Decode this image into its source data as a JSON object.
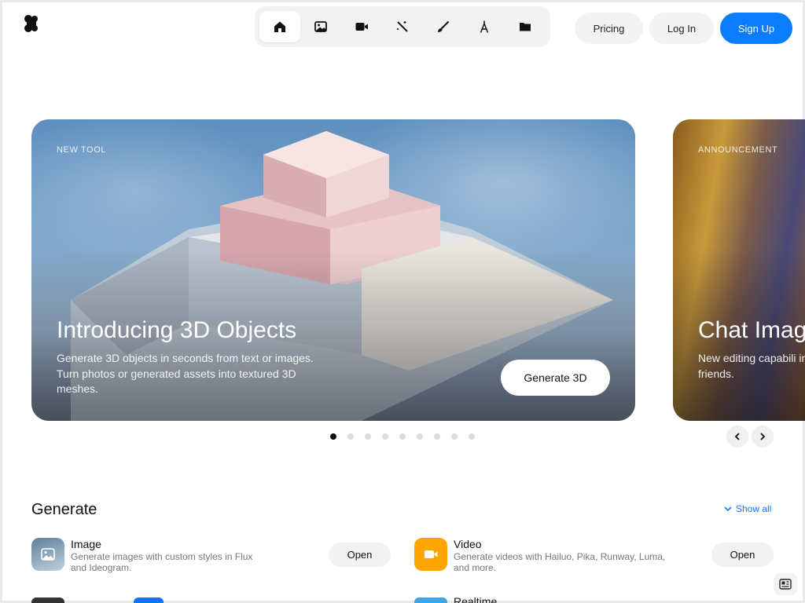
{
  "header": {
    "logo_icon": "krea-logo-icon",
    "nav": [
      {
        "icon": "home-icon",
        "active": true
      },
      {
        "icon": "image-icon",
        "active": false
      },
      {
        "icon": "video-camera-icon",
        "active": false
      },
      {
        "icon": "magic-wand-icon",
        "active": false
      },
      {
        "icon": "brush-icon",
        "active": false
      },
      {
        "icon": "pen-nib-icon",
        "active": false
      },
      {
        "icon": "folder-icon",
        "active": false
      }
    ],
    "pricing_label": "Pricing",
    "login_label": "Log In",
    "signup_label": "Sign Up"
  },
  "hero": {
    "cards": [
      {
        "eyebrow": "NEW TOOL",
        "title": "Introducing 3D Objects",
        "description": "Generate 3D objects in seconds from text or images. Turn photos or generated assets into textured 3D meshes.",
        "button_label": "Generate 3D"
      },
      {
        "eyebrow": "ANNOUNCEMENT",
        "title": "Chat Imag",
        "description": "New editing capabili into paintings, swap y your friends."
      }
    ],
    "dots_total": 9,
    "dots_active": 0
  },
  "generate": {
    "title": "Generate",
    "show_all_label": "Show all",
    "tools": [
      {
        "icon": "image-icon",
        "name": "Image",
        "description": "Generate images with custom styles in Flux and Ideogram.",
        "button_label": "Open"
      },
      {
        "icon": "video-camera-icon",
        "name": "Video",
        "description": "Generate videos with Hailuo, Pika, Runway, Luma, and more.",
        "button_label": "Open"
      },
      {
        "name": "Realtime"
      }
    ]
  },
  "colors": {
    "accent": "#0a7cff",
    "video_tile": "#ffa500"
  }
}
